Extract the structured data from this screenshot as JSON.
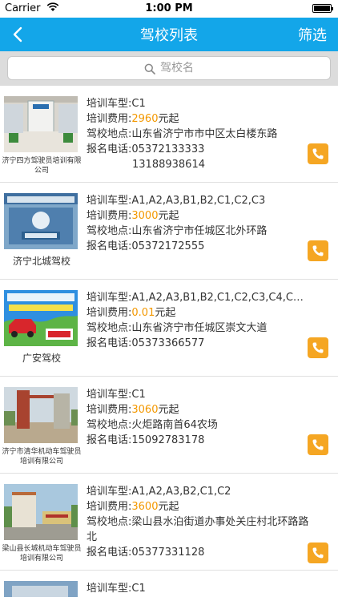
{
  "status": {
    "carrier": "Carrier",
    "time": "1:00 PM"
  },
  "nav": {
    "title": "驾校列表",
    "filter": "筛选"
  },
  "search": {
    "placeholder": "驾校名"
  },
  "colors": {
    "nav": "#13a6e9",
    "price": "#f39800",
    "call": "#f5a623"
  },
  "labels": {
    "car_type": "培训车型:",
    "fee": "培训费用:",
    "location": "驾校地点:",
    "phone": "报名电话:",
    "fee_suffix": "元起"
  },
  "schools": [
    {
      "name": "济宁四方驾驶员培训有限公司",
      "car_types": "C1",
      "fee": "2960",
      "location": "山东省济宁市市中区太白楼东路",
      "phone": "05372133333",
      "phone2": "13188938614"
    },
    {
      "name": "济宁北城驾校",
      "car_types": "A1,A2,A3,B1,B2,C1,C2,C3",
      "fee": "3000",
      "location": "山东省济宁市任城区北外环路",
      "phone": "05372172555"
    },
    {
      "name": "广安驾校",
      "car_types": "A1,A2,A3,B1,B2,C1,C2,C3,C4,C…",
      "fee": "0.01",
      "location": "山东省济宁市任城区崇文大道",
      "phone": "05373366577"
    },
    {
      "name": "济宁市清华机动车驾驶员培训有限公司",
      "car_types": "C1",
      "fee": "3060",
      "location": "火炬路南首64农场",
      "phone": "15092783178"
    },
    {
      "name": "梁山县长城机动车驾驶员培训有限公司",
      "car_types": "A1,A2,A3,B2,C1,C2",
      "fee": "3600",
      "location": "梁山县水泊街道办事处关庄村北环路路北",
      "phone": "05377331128"
    },
    {
      "car_types": "C1"
    }
  ]
}
